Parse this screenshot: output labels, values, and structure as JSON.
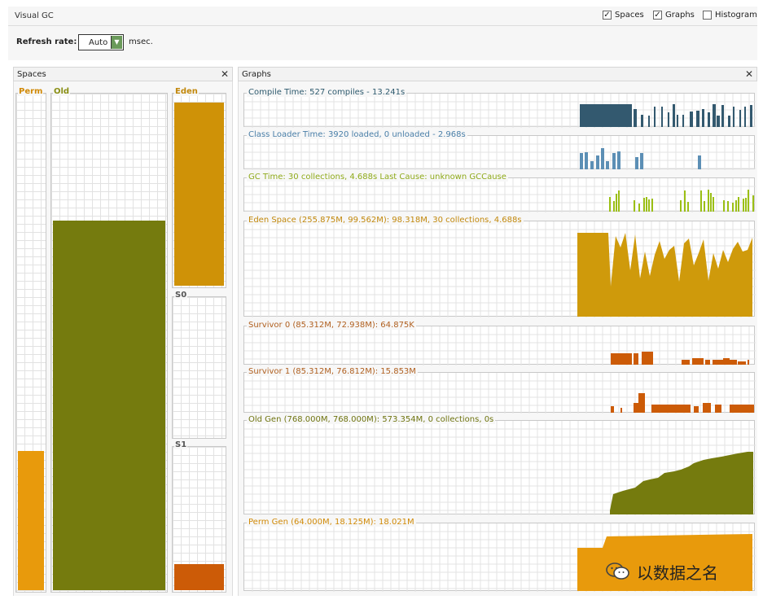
{
  "window": {
    "title": "Visual GC"
  },
  "toggles": [
    {
      "label": "Spaces",
      "checked": true
    },
    {
      "label": "Graphs",
      "checked": true
    },
    {
      "label": "Histogram",
      "checked": false
    }
  ],
  "refresh": {
    "label": "Refresh rate:",
    "value": "Auto",
    "unit": "msec."
  },
  "spaces_panel": {
    "title": "Spaces",
    "close": "✕",
    "columns": [
      {
        "label": "Perm",
        "fill": 0.282,
        "color": "#e89a0c",
        "label_color": "#d18a08"
      },
      {
        "label": "Old",
        "fill": 0.746,
        "color": "#757b0e",
        "label_color": "#8a8f15"
      },
      {
        "label": "Eden",
        "fill": 0.963,
        "color": "#cf9207",
        "label_color": "#c2880c"
      },
      {
        "label": "S0",
        "fill": 0.0,
        "color": "#cc5b07",
        "label_color": "#555555"
      },
      {
        "label": "S1",
        "fill": 0.183,
        "color": "#cc5b07",
        "label_color": "#555555"
      }
    ]
  },
  "graphs_panel": {
    "title": "Graphs",
    "close": "✕",
    "graphs": [
      {
        "title": "Compile Time: 527 compiles - 13.241s",
        "title_color": "#2e5a6e",
        "color": "#33596f"
      },
      {
        "title": "Class Loader Time: 3920 loaded, 0 unloaded - 2.968s",
        "title_color": "#4a7fa8",
        "color": "#5c8fb5"
      },
      {
        "title": "GC Time: 30 collections, 4.688s  Last Cause: unknown GCCause",
        "title_color": "#8faa1a",
        "color": "#9bbf14"
      },
      {
        "title": "Eden Space (255.875M, 99.562M): 98.318M, 30 collections, 4.688s",
        "title_color": "#c2880c",
        "color": "#cf9a0b"
      },
      {
        "title": "Survivor 0 (85.312M, 72.938M): 64.875K",
        "title_color": "#b06020",
        "color": "#cc5b07"
      },
      {
        "title": "Survivor 1 (85.312M, 76.812M): 15.853M",
        "title_color": "#b06020",
        "color": "#cc5b07"
      },
      {
        "title": "Old Gen (768.000M, 768.000M): 573.354M, 0 collections, 0s",
        "title_color": "#6f7410",
        "color": "#757b0e"
      },
      {
        "title": "Perm Gen (64.000M, 18.125M): 18.021M",
        "title_color": "#d18a08",
        "color": "#e89a0c"
      }
    ]
  },
  "watermark": {
    "text": "以数据之名",
    "icon": "wechat-icon"
  }
}
